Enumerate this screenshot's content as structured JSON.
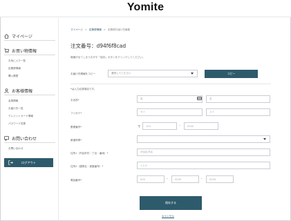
{
  "header": {
    "logo": "Yomite"
  },
  "sidebar": {
    "mypage": "マイページ",
    "orders_title": "お買い物情報",
    "orders_items": [
      "お気に入り一覧",
      "定期便情報",
      "購入履歴"
    ],
    "member_title": "お客様情報",
    "member_items": [
      "会員情報",
      "お届け先一覧",
      "クレジットカード情報",
      "パスワード変更"
    ],
    "contact_title": "お問い合わせ",
    "contact_items": [
      "お問い合わせ"
    ],
    "logout": "ログアウト"
  },
  "breadcrumb": {
    "items": [
      "マイページ",
      "定期便情報",
      "定期便お届け先編集"
    ]
  },
  "page": {
    "title": "注文番号：d94f6f8cad",
    "hint": "機種が出てしまうおがす「保存」ボタンをクリックしてください。",
    "required_note": "*は入力必須項目です。"
  },
  "form": {
    "copy_label": "お届け先情報をコピー",
    "copy_select": "選択してください",
    "copy_button": "コピー",
    "name_label": "お名前*",
    "last_name_ph": "姓",
    "first_name_ph": "名",
    "kana_label": "フリガナ*",
    "last_kana_ph": "セイ",
    "first_kana_ph": "メイ",
    "zip_label": "郵便番号*",
    "zip_prefix": "〒",
    "zip1_ph": "150",
    "zip2_ph": "0000",
    "pref_label": "都道府県*",
    "pref_value": "",
    "addr1_label": "住所1（市区町村・丁目・番地）*",
    "addr1_ph": "渋谷区渋谷",
    "addr2_label": "住所2（建物名・部屋番号）*",
    "addr2_ph": "1-2-3",
    "phone_label": "電話番号*",
    "phone1_ph": "000",
    "phone2_ph": "0000",
    "phone3_ph": "0000",
    "dash": "-",
    "submit": "保存する",
    "cancel": "キャンセル"
  },
  "colors": {
    "accent": "#2e5b6b"
  }
}
